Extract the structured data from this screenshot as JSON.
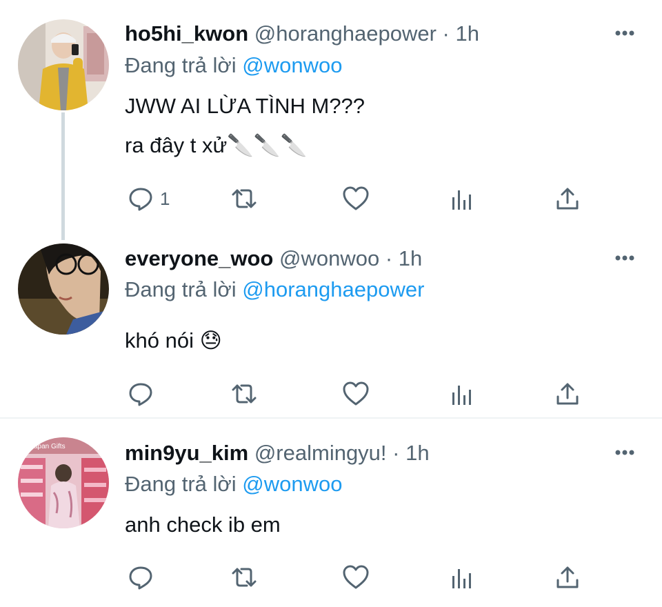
{
  "colors": {
    "text": "#0f1419",
    "secondary": "#536471",
    "link": "#1d9bf0",
    "divider": "#eff3f4",
    "thread_line": "#cfd9de"
  },
  "tweets": [
    {
      "display_name": "ho5hi_kwon",
      "handle": "@horanghaepower",
      "separator": "·",
      "time": "1h",
      "replying_prefix": "Đang trả lời",
      "replying_to": "@wonwoo",
      "lines": [
        "JWW AI LỪA TÌNH M???",
        "ra đây t xử🔪🔪🔪"
      ],
      "reply_count": "1",
      "icons": [
        "more-icon",
        "reply-icon",
        "retweet-icon",
        "like-icon",
        "analytics-icon",
        "share-icon"
      ]
    },
    {
      "display_name": "everyone_woo",
      "handle": "@wonwoo",
      "separator": "·",
      "time": "1h",
      "replying_prefix": "Đang trả lời",
      "replying_to": "@horanghaepower",
      "lines": [
        "khó nói 😓"
      ],
      "reply_count": "",
      "icons": [
        "more-icon",
        "reply-icon",
        "retweet-icon",
        "like-icon",
        "analytics-icon",
        "share-icon"
      ]
    },
    {
      "display_name": "min9yu_kim",
      "handle": "@realmingyu!",
      "separator": "·",
      "time": "1h",
      "replying_prefix": "Đang trả lời",
      "replying_to": "@wonwoo",
      "lines": [
        "anh check ib em"
      ],
      "reply_count": "",
      "avatar_sign_text": "Japan Gifts",
      "icons": [
        "more-icon",
        "reply-icon",
        "retweet-icon",
        "like-icon",
        "analytics-icon",
        "share-icon"
      ]
    }
  ]
}
